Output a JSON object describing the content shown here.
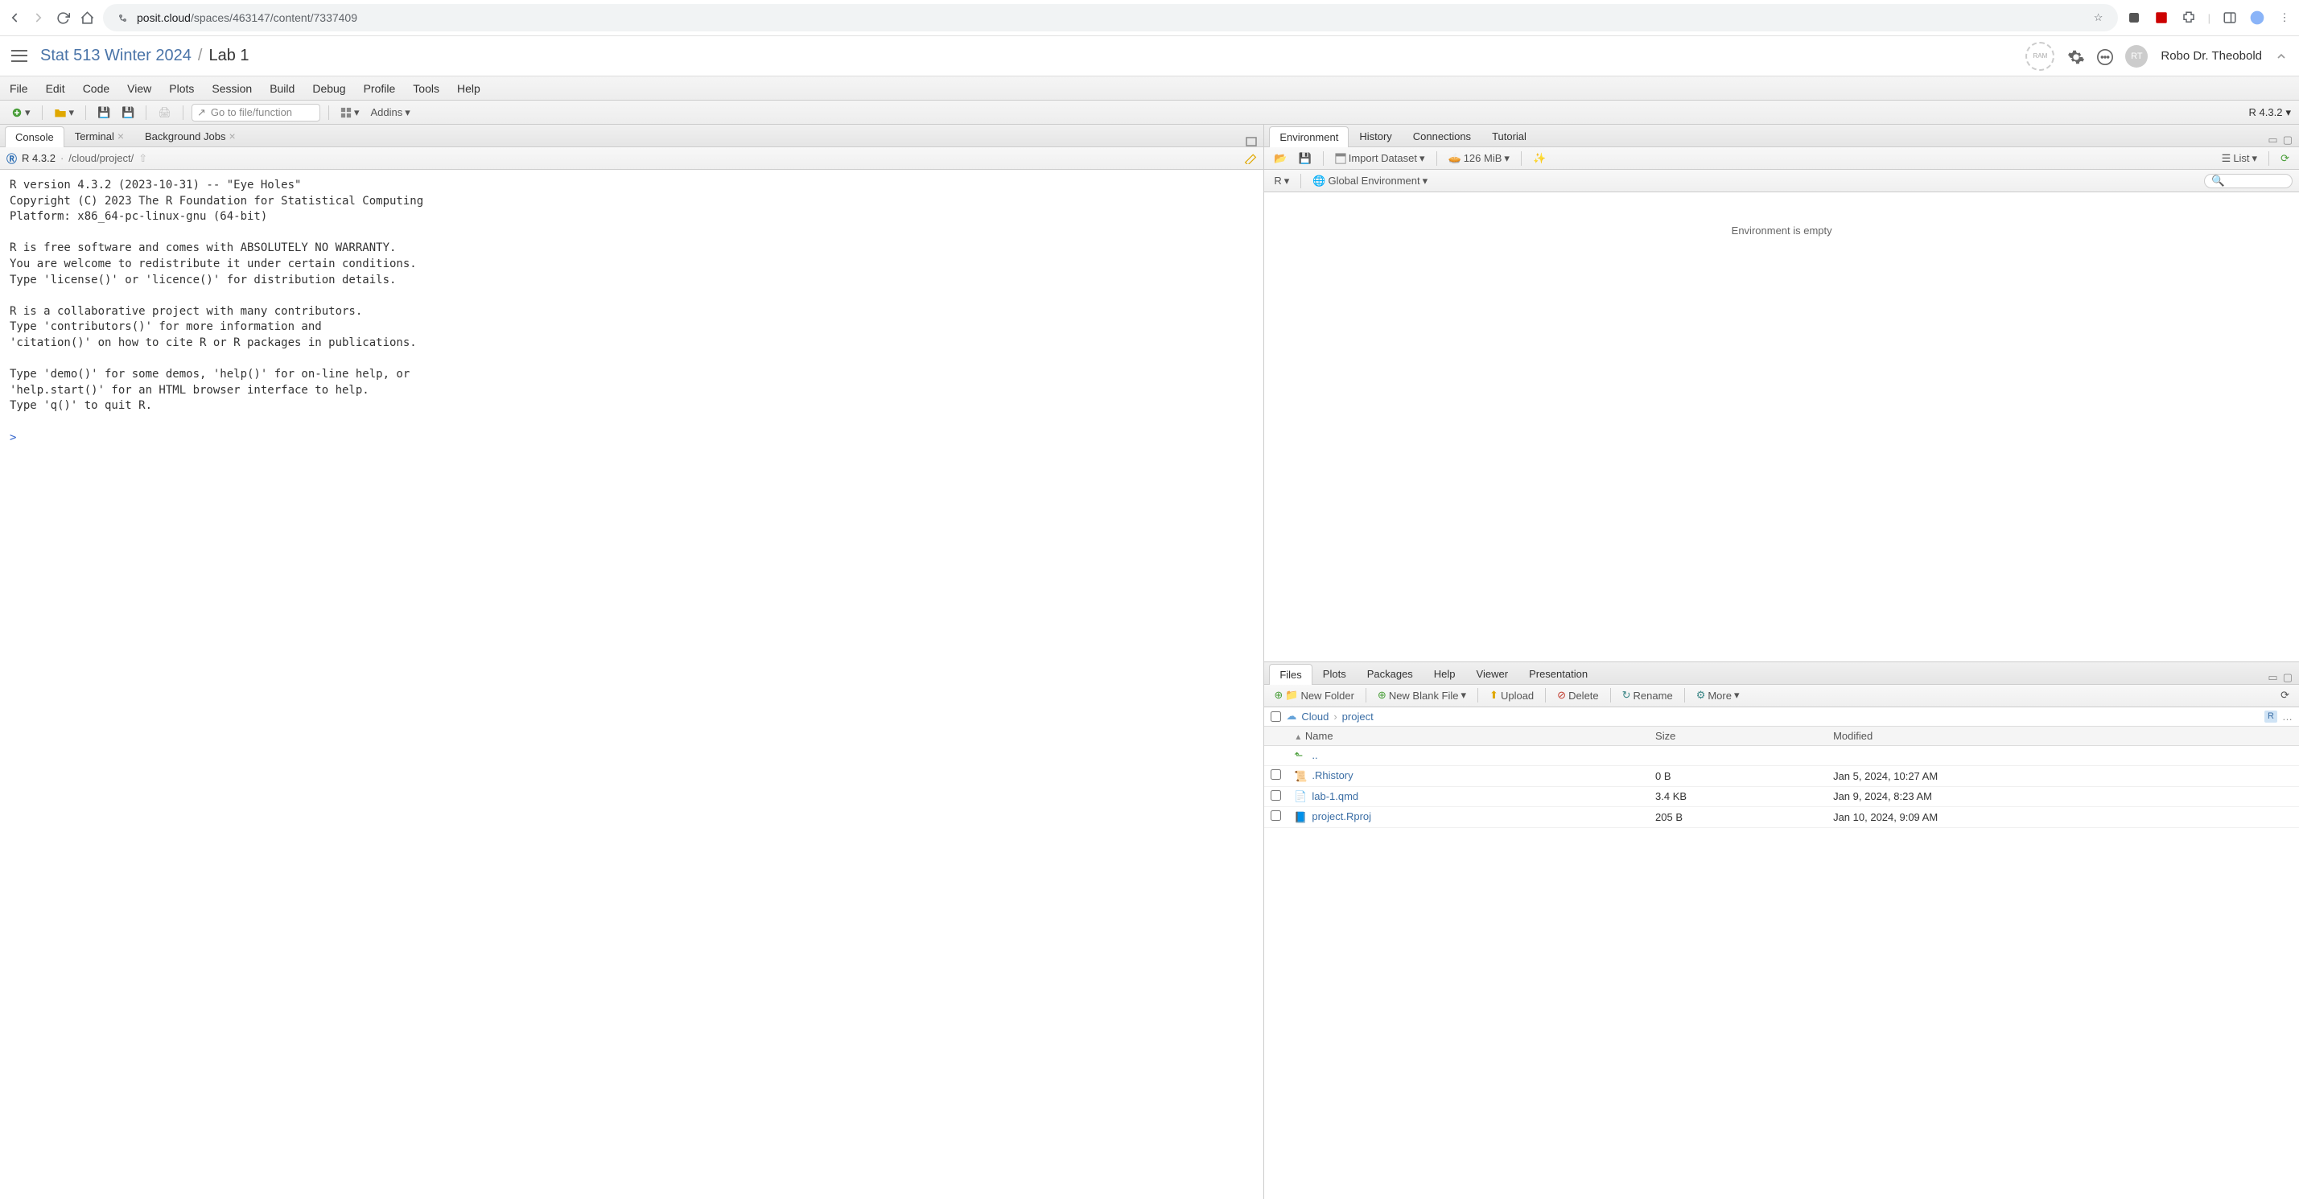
{
  "browser": {
    "url_host": "posit.cloud",
    "url_path": "/spaces/463147/content/7337409"
  },
  "posit": {
    "breadcrumb_space": "Stat 513 Winter 2024",
    "breadcrumb_sep": "/",
    "breadcrumb_current": "Lab 1",
    "ram_label": "RAM",
    "user_initials": "RT",
    "user_name": "Robo Dr. Theobold"
  },
  "menubar": [
    "File",
    "Edit",
    "Code",
    "View",
    "Plots",
    "Session",
    "Build",
    "Debug",
    "Profile",
    "Tools",
    "Help"
  ],
  "main_toolbar": {
    "goto_placeholder": "Go to file/function",
    "addins_label": "Addins",
    "r_version": "R 4.3.2"
  },
  "left_pane": {
    "tabs": [
      "Console",
      "Terminal",
      "Background Jobs"
    ],
    "active_tab": 0,
    "console_info_version": "R 4.3.2",
    "console_info_sep": "·",
    "console_info_path": "/cloud/project/",
    "console_text": "R version 4.3.2 (2023-10-31) -- \"Eye Holes\"\nCopyright (C) 2023 The R Foundation for Statistical Computing\nPlatform: x86_64-pc-linux-gnu (64-bit)\n\nR is free software and comes with ABSOLUTELY NO WARRANTY.\nYou are welcome to redistribute it under certain conditions.\nType 'license()' or 'licence()' for distribution details.\n\nR is a collaborative project with many contributors.\nType 'contributors()' for more information and\n'citation()' on how to cite R or R packages in publications.\n\nType 'demo()' for some demos, 'help()' for on-line help, or\n'help.start()' for an HTML browser interface to help.\nType 'q()' to quit R.\n",
    "prompt": ">"
  },
  "env_pane": {
    "tabs": [
      "Environment",
      "History",
      "Connections",
      "Tutorial"
    ],
    "active_tab": 0,
    "import_label": "Import Dataset",
    "memory": "126 MiB",
    "list_label": "List",
    "scope_label": "R",
    "env_label": "Global Environment",
    "empty_text": "Environment is empty"
  },
  "files_pane": {
    "tabs": [
      "Files",
      "Plots",
      "Packages",
      "Help",
      "Viewer",
      "Presentation"
    ],
    "active_tab": 0,
    "toolbar": {
      "new_folder": "New Folder",
      "new_blank": "New Blank File",
      "upload": "Upload",
      "delete": "Delete",
      "rename": "Rename",
      "more": "More"
    },
    "breadcrumb": [
      "Cloud",
      "project"
    ],
    "columns": [
      "Name",
      "Size",
      "Modified"
    ],
    "up_dir": "..",
    "rows": [
      {
        "name": ".Rhistory",
        "size": "0 B",
        "modified": "Jan 5, 2024, 10:27 AM",
        "icon": "rhistory"
      },
      {
        "name": "lab-1.qmd",
        "size": "3.4 KB",
        "modified": "Jan 9, 2024, 8:23 AM",
        "icon": "qmd"
      },
      {
        "name": "project.Rproj",
        "size": "205 B",
        "modified": "Jan 10, 2024, 9:09 AM",
        "icon": "rproj"
      }
    ]
  }
}
